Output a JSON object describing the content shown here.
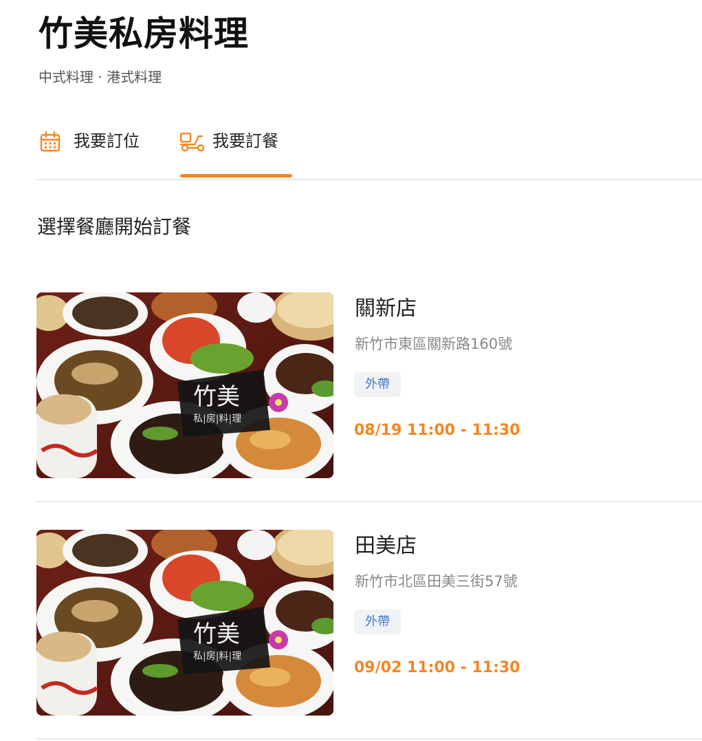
{
  "header": {
    "title": "竹美私房料理",
    "subtitle": "中式料理 · 港式料理"
  },
  "tabs": [
    {
      "label": "我要訂位",
      "icon": "calendar-icon",
      "active": false
    },
    {
      "label": "我要訂餐",
      "icon": "scooter-icon",
      "active": true
    }
  ],
  "section": {
    "title": "選擇餐廳開始訂餐"
  },
  "stores": [
    {
      "name": "關新店",
      "address": "新竹市東區關新路160號",
      "tag": "外帶",
      "time": "08/19 11:00 - 11:30",
      "logo": {
        "main": "竹美",
        "sub": "私|房|料|理"
      }
    },
    {
      "name": "田美店",
      "address": "新竹市北區田美三街57號",
      "tag": "外帶",
      "time": "09/02 11:00 - 11:30",
      "logo": {
        "main": "竹美",
        "sub": "私|房|料|理"
      }
    }
  ],
  "colors": {
    "accent": "#f5861f",
    "tag_text": "#4a78c9",
    "tag_bg": "#f1f2f4",
    "divider": "#e8e8e8"
  }
}
